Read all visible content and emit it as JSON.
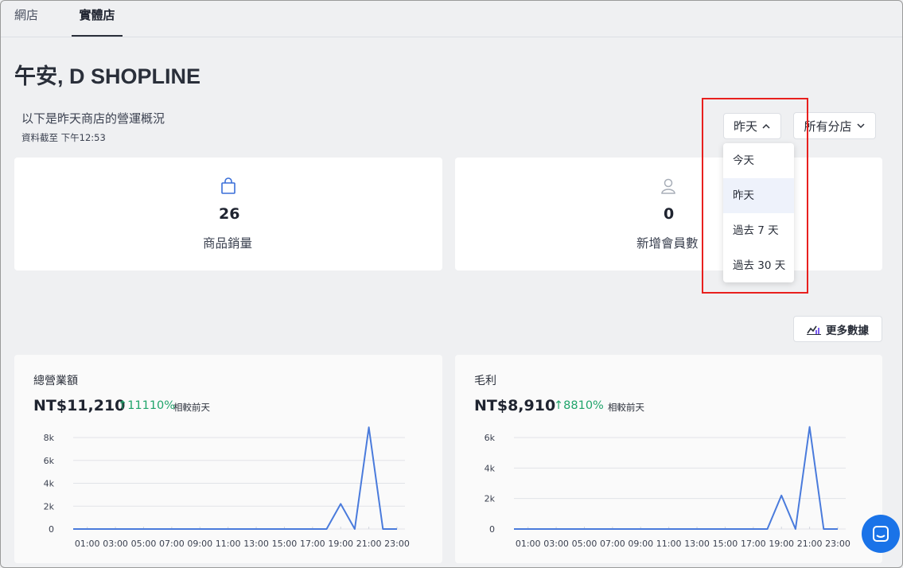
{
  "tabs": [
    {
      "label": "網店"
    },
    {
      "label": "實體店"
    }
  ],
  "greeting": "午安, D SHOPLINE",
  "subtitle": "以下是昨天商店的營運概況",
  "as_of": "資料截至 下午12:53",
  "date_filter": {
    "selected": "昨天",
    "options": [
      "今天",
      "昨天",
      "過去 7 天",
      "過去 30 天"
    ]
  },
  "branch_filter": {
    "selected": "所有分店"
  },
  "stats": [
    {
      "icon": "shopping-bag-icon",
      "value": "26",
      "label": "商品銷量"
    },
    {
      "icon": "user-icon",
      "value": "0",
      "label": "新增會員數"
    }
  ],
  "more_data_label": "更多數據",
  "colors": {
    "accent": "#4a7bdc",
    "growth": "#20a46b",
    "highlight": "#e8201e",
    "chat": "#1a73e8"
  },
  "cards": [
    {
      "title": "總營業額",
      "amount": "NT$11,210",
      "growth": "11110%",
      "compare": "相較前天"
    },
    {
      "title": "毛利",
      "amount": "NT$8,910",
      "growth": "8810%",
      "compare": "相較前天"
    }
  ],
  "chart_data": [
    {
      "type": "line",
      "title": "總營業額",
      "x": [
        "00:00",
        "01:00",
        "02:00",
        "03:00",
        "04:00",
        "05:00",
        "06:00",
        "07:00",
        "08:00",
        "09:00",
        "10:00",
        "11:00",
        "12:00",
        "13:00",
        "14:00",
        "15:00",
        "16:00",
        "17:00",
        "18:00",
        "19:00",
        "20:00",
        "21:00",
        "22:00",
        "23:00"
      ],
      "x_tick_labels": [
        "01:00",
        "03:00",
        "05:00",
        "07:00",
        "09:00",
        "11:00",
        "13:00",
        "15:00",
        "17:00",
        "19:00",
        "21:00",
        "23:00"
      ],
      "y_tick_labels": [
        "0",
        "2k",
        "4k",
        "6k",
        "8k"
      ],
      "ylim": [
        0,
        9000
      ],
      "values": [
        0,
        0,
        0,
        0,
        0,
        0,
        0,
        0,
        0,
        0,
        0,
        0,
        0,
        0,
        0,
        0,
        0,
        0,
        0,
        2200,
        0,
        8900,
        0,
        0
      ],
      "grid": true
    },
    {
      "type": "line",
      "title": "毛利",
      "x": [
        "00:00",
        "01:00",
        "02:00",
        "03:00",
        "04:00",
        "05:00",
        "06:00",
        "07:00",
        "08:00",
        "09:00",
        "10:00",
        "11:00",
        "12:00",
        "13:00",
        "14:00",
        "15:00",
        "16:00",
        "17:00",
        "18:00",
        "19:00",
        "20:00",
        "21:00",
        "22:00",
        "23:00"
      ],
      "x_tick_labels": [
        "01:00",
        "03:00",
        "05:00",
        "07:00",
        "09:00",
        "11:00",
        "13:00",
        "15:00",
        "17:00",
        "19:00",
        "21:00",
        "23:00"
      ],
      "y_tick_labels": [
        "0",
        "2k",
        "4k",
        "6k"
      ],
      "ylim": [
        0,
        7000
      ],
      "values": [
        0,
        0,
        0,
        0,
        0,
        0,
        0,
        0,
        0,
        0,
        0,
        0,
        0,
        0,
        0,
        0,
        0,
        0,
        0,
        2200,
        0,
        6700,
        0,
        0
      ],
      "grid": true
    }
  ]
}
